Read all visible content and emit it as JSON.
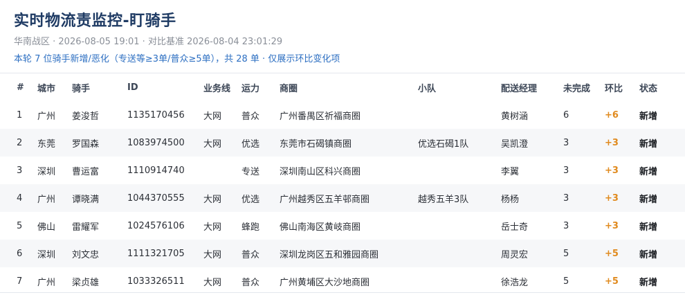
{
  "header": {
    "title": "实时物流责监控-盯骑手",
    "meta": "华南战区 · 2026-08-05 19:01 · 对比基准 2026-08-04 23:01:29",
    "notice": "本轮 7 位骑手新增/恶化（专送等≥3单/普众≥5单），共 28 单 · 仅展示环比变化项"
  },
  "table": {
    "columns": [
      "#",
      "城市",
      "骑手",
      "ID",
      "业务线",
      "运力",
      "商圈",
      "小队",
      "配送经理",
      "未完成",
      "环比",
      "状态"
    ],
    "rows": [
      {
        "idx": "1",
        "city": "广州",
        "rider": "姜浚哲",
        "id": "1135170456",
        "line": "大网",
        "capacity": "普众",
        "area": "广州番禺区祈福商圈",
        "team": "",
        "manager": "黄树涵",
        "undone": "6",
        "delta": "+6",
        "status": "新增"
      },
      {
        "idx": "2",
        "city": "东莞",
        "rider": "罗国森",
        "id": "1083974500",
        "line": "大网",
        "capacity": "优选",
        "area": "东莞市石碣镇商圈",
        "team": "优选石碣1队",
        "manager": "吴凯澄",
        "undone": "3",
        "delta": "+3",
        "status": "新增"
      },
      {
        "idx": "3",
        "city": "深圳",
        "rider": "曹运富",
        "id": "1110914740",
        "line": "",
        "capacity": "专送",
        "area": "深圳南山区科兴商圈",
        "team": "",
        "manager": "李翼",
        "undone": "3",
        "delta": "+3",
        "status": "新增"
      },
      {
        "idx": "4",
        "city": "广州",
        "rider": "谭晓满",
        "id": "1044370555",
        "line": "大网",
        "capacity": "优选",
        "area": "广州越秀区五羊邨商圈",
        "team": "越秀五羊3队",
        "manager": "杨杨",
        "undone": "3",
        "delta": "+3",
        "status": "新增"
      },
      {
        "idx": "5",
        "city": "佛山",
        "rider": "雷耀军",
        "id": "1024576106",
        "line": "大网",
        "capacity": "蜂跑",
        "area": "佛山南海区黄岐商圈",
        "team": "",
        "manager": "岳士奇",
        "undone": "3",
        "delta": "+3",
        "status": "新增"
      },
      {
        "idx": "6",
        "city": "深圳",
        "rider": "刘文忠",
        "id": "1111321705",
        "line": "大网",
        "capacity": "普众",
        "area": "深圳龙岗区五和雅园商圈",
        "team": "",
        "manager": "周灵宏",
        "undone": "5",
        "delta": "+5",
        "status": "新增"
      },
      {
        "idx": "7",
        "city": "广州",
        "rider": "梁贞雄",
        "id": "1033326511",
        "line": "大网",
        "capacity": "普众",
        "area": "广州黄埔区大沙地商圈",
        "team": "",
        "manager": "徐浩龙",
        "undone": "5",
        "delta": "+5",
        "status": "新增"
      }
    ]
  }
}
